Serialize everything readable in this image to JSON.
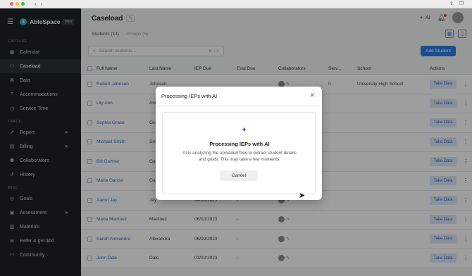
{
  "app": {
    "brand": "AbleSpace",
    "plan_badge": "Plus",
    "logo_letter": "a"
  },
  "sidebar": {
    "sections": [
      {
        "label": "CAPTURE",
        "items": [
          {
            "label": "Calendar",
            "icon": "calendar-icon",
            "glyph": "▦"
          },
          {
            "label": "Caseload",
            "icon": "caseload-icon",
            "glyph": "⚇",
            "active": true
          },
          {
            "label": "Data",
            "icon": "data-icon",
            "glyph": "⌘"
          },
          {
            "label": "Accommodations",
            "icon": "accommodations-icon",
            "glyph": "⌗"
          },
          {
            "label": "Service Time",
            "icon": "clock-icon",
            "glyph": "◷"
          }
        ]
      },
      {
        "label": "TRACK",
        "items": [
          {
            "label": "Report",
            "icon": "report-icon",
            "glyph": "↗",
            "expandable": true
          },
          {
            "label": "Billing",
            "icon": "billing-icon",
            "glyph": "▤",
            "expandable": true
          },
          {
            "label": "Collaborators",
            "icon": "collaborators-icon",
            "glyph": "⚉"
          },
          {
            "label": "History",
            "icon": "history-icon",
            "glyph": "↺"
          }
        ]
      },
      {
        "label": "MISC",
        "items": [
          {
            "label": "Goals",
            "icon": "goals-icon",
            "glyph": "◎"
          },
          {
            "label": "Assessment",
            "icon": "assessment-icon",
            "glyph": "▣",
            "expandable": true
          },
          {
            "label": "Materials",
            "icon": "materials-icon",
            "glyph": "▥"
          },
          {
            "label": "Refer & get $50",
            "icon": "gift-icon",
            "glyph": "⊞"
          },
          {
            "label": "Community",
            "icon": "community-icon",
            "glyph": "⚇"
          }
        ]
      }
    ]
  },
  "header": {
    "title": "Caseload",
    "ai_label": "AI"
  },
  "tabs": [
    {
      "label": "Students (14)",
      "active": true
    },
    {
      "label": "Groups (5)",
      "active": false
    }
  ],
  "search": {
    "placeholder": "Search students...",
    "shortcut": "⌘ + K"
  },
  "add_button": "Add Student",
  "table": {
    "headers": {
      "full_name": "Full Name",
      "last_name": "Last Name",
      "iep_due": "IEP Due",
      "eval_due": "Eval Due",
      "collaborators": "Collaborators",
      "services": "Serv...",
      "school": "School",
      "actions": "Actions"
    },
    "action_label": "Take Data",
    "rows": [
      {
        "full_name": "Robert Johnson",
        "last_name": "Johnson",
        "iep_due": "",
        "eval_due": "",
        "services": "0",
        "school": "University High School"
      },
      {
        "full_name": "Lily Ann",
        "last_name": "Ann",
        "iep_due": "",
        "eval_due": "",
        "services": "",
        "school": ""
      },
      {
        "full_name": "Sophia Grace",
        "last_name": "Grace",
        "iep_due": "",
        "eval_due": "",
        "services": "",
        "school": ""
      },
      {
        "full_name": "Michael Smith",
        "last_name": "Smith",
        "iep_due": "",
        "eval_due": "",
        "services": "",
        "school": ""
      },
      {
        "full_name": "Bill Gartner",
        "last_name": "Gartner",
        "iep_due": "",
        "eval_due": "",
        "services": "",
        "school": ""
      },
      {
        "full_name": "Maria Garcia",
        "last_name": "Garcia",
        "iep_due": "",
        "eval_due": "",
        "services": "",
        "school": ""
      },
      {
        "full_name": "Aaron Jay",
        "last_name": "Jay",
        "iep_due": "04/06/2023",
        "eval_due": "-",
        "services": "",
        "school": ""
      },
      {
        "full_name": "Maria Martinez",
        "last_name": "Martinez",
        "iep_due": "06/10/2023",
        "eval_due": "-",
        "services": "",
        "school": ""
      },
      {
        "full_name": "Sarah Alexandra",
        "last_name": "Alexandra",
        "iep_due": "06/09/2023",
        "eval_due": "-",
        "services": "",
        "school": ""
      },
      {
        "full_name": "John Dale",
        "last_name": "Dale",
        "iep_due": "03/02/2023",
        "eval_due": "-",
        "services": "",
        "school": ""
      }
    ]
  },
  "modal": {
    "title": "Processing IEPs with AI",
    "heading": "Processing IEPs with AI",
    "description": "AI is analyzing the uploaded files to extract student details and goals. This may take a few moments.",
    "cancel_label": "Cancel"
  }
}
